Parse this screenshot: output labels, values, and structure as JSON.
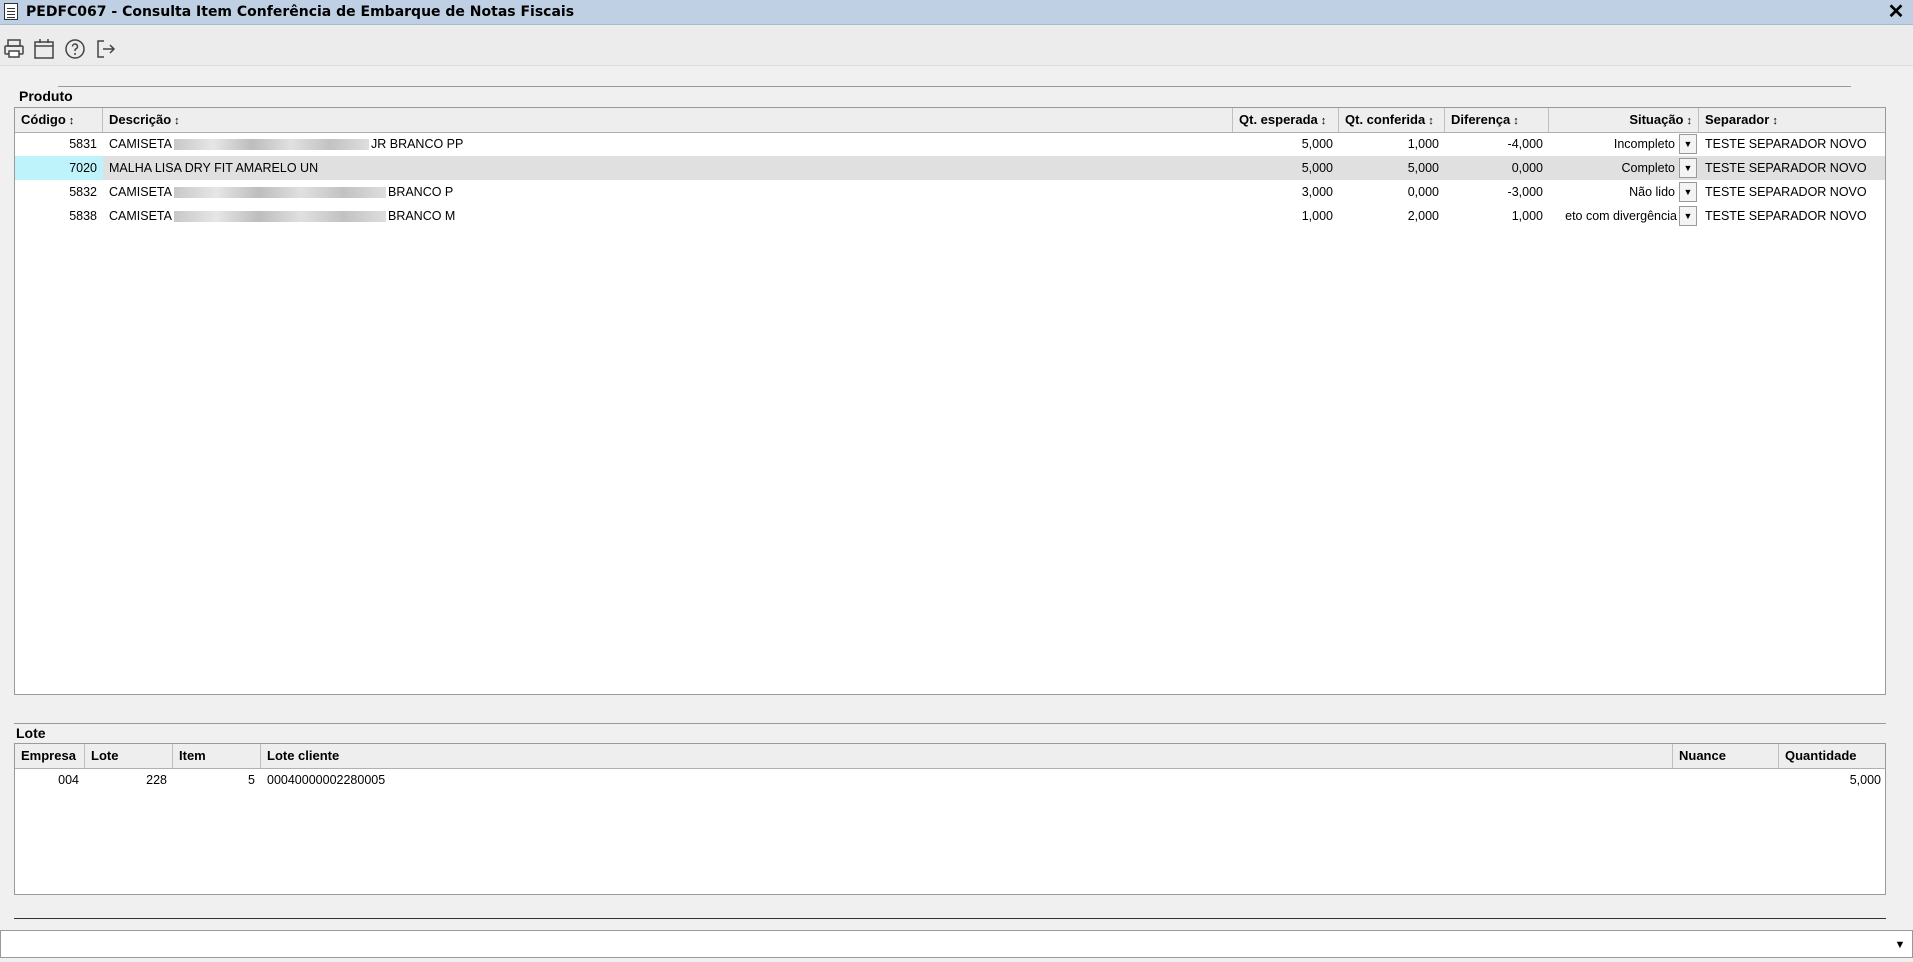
{
  "window": {
    "title": "PEDFC067 - Consulta Item Conferência de Embarque de Notas Fiscais",
    "close_label": "✕"
  },
  "toolbar": {
    "icons": [
      "printer-icon",
      "calendar-icon",
      "help-icon",
      "exit-icon"
    ]
  },
  "produto": {
    "section_label": "Produto",
    "columns": {
      "codigo": "Código",
      "descricao": "Descrição",
      "qt_esperada": "Qt. esperada",
      "qt_conferida": "Qt. conferida",
      "diferenca": "Diferença",
      "situacao": "Situação",
      "separador": "Separador"
    },
    "sort_glyph": "↕",
    "rows": [
      {
        "codigo": "5831",
        "desc_pre": "CAMISETA",
        "desc_post": "JR BRANCO PP",
        "qt_esperada": "5,000",
        "qt_conferida": "1,000",
        "diferenca": "-4,000",
        "situacao": "Incompleto",
        "separador": "TESTE SEPARADOR NOVO"
      },
      {
        "codigo": "7020",
        "desc_pre": "MALHA LISA DRY FIT AMARELO UN",
        "desc_post": "",
        "qt_esperada": "5,000",
        "qt_conferida": "5,000",
        "diferenca": "0,000",
        "situacao": "Completo",
        "separador": "TESTE SEPARADOR NOVO"
      },
      {
        "codigo": "5832",
        "desc_pre": "CAMISETA",
        "desc_post": "BRANCO P",
        "qt_esperada": "3,000",
        "qt_conferida": "0,000",
        "diferenca": "-3,000",
        "situacao": "Não lido",
        "separador": "TESTE SEPARADOR NOVO"
      },
      {
        "codigo": "5838",
        "desc_pre": "CAMISETA",
        "desc_post": "BRANCO M",
        "qt_esperada": "1,000",
        "qt_conferida": "2,000",
        "diferenca": "1,000",
        "situacao": "eto com divergência",
        "separador": "TESTE SEPARADOR NOVO"
      }
    ]
  },
  "lote": {
    "section_label": "Lote",
    "columns": {
      "empresa": "Empresa",
      "lote": "Lote",
      "item": "Item",
      "lote_cliente": "Lote cliente",
      "nuance": "Nuance",
      "quantidade": "Quantidade"
    },
    "rows": [
      {
        "empresa": "004",
        "lote": "228",
        "item": "5",
        "lote_cliente": "00040000002280005",
        "nuance": "",
        "quantidade": "5,000"
      }
    ]
  },
  "colors": {
    "selected_row": "#e0e0e0",
    "focus_cell": "#bff3fb",
    "titlebar": "#bfd0e4"
  }
}
